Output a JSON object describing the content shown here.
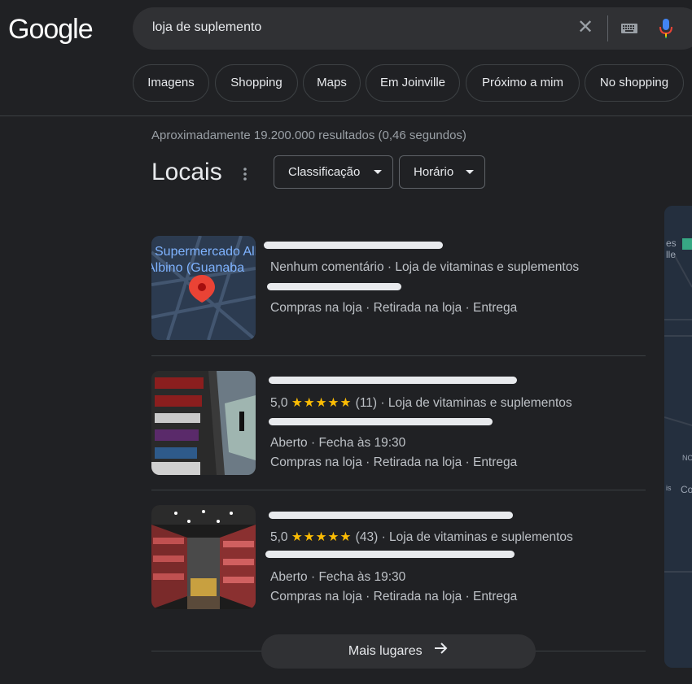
{
  "header": {
    "logo": "Google",
    "search": {
      "value": "loja de suplemento",
      "clear_icon": "close-icon",
      "keyboard_icon": "keyboard-icon",
      "mic_icon": "mic-icon"
    }
  },
  "chips": [
    "Imagens",
    "Shopping",
    "Maps",
    "Em Joinville",
    "Próximo a mim",
    "No shopping"
  ],
  "stats": "Aproximadamente 19.200.000 resultados (0,46 segundos)",
  "locals": {
    "title": "Locais",
    "filters": [
      "Classificação",
      "Horário"
    ],
    "results": [
      {
        "rating_line": "Nenhum comentário · Loja de vitaminas e suplementos",
        "status": "",
        "services": "Compras na loja · Retirada na loja · Entrega",
        "thumb_label": "Supermercado Albino (Guanabara)"
      },
      {
        "rating": "5,0",
        "stars": "★★★★★",
        "reviews": "(11)",
        "category": "· Loja de vitaminas e suplementos",
        "status": "Aberto · Fecha às 19:30",
        "services": "Compras na loja · Retirada na loja · Entrega"
      },
      {
        "rating": "5,0",
        "stars": "★★★★★",
        "reviews": "(43)",
        "category": "· Loja de vitaminas e suplementos",
        "status": "Aberto · Fecha às 19:30",
        "services": "Compras na loja · Retirada na loja · Entrega"
      }
    ],
    "more_button": "Mais lugares"
  },
  "colors": {
    "background": "#202124",
    "star": "#fbbc04",
    "pin": "#ea4335",
    "map_bg": "#242f3e"
  }
}
